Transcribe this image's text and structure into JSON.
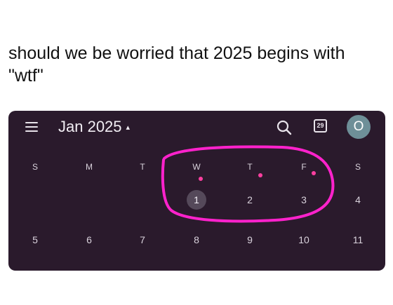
{
  "caption": "should we be worried that 2025 begins with \"wtf\"",
  "header": {
    "month_title": "Jan 2025",
    "caret": "▴",
    "today_badge": "29",
    "avatar_initial": "O"
  },
  "weekdays": [
    "S",
    "M",
    "T",
    "W",
    "T",
    "F",
    "S"
  ],
  "weeks": [
    [
      "",
      "",
      "",
      "1",
      "2",
      "3",
      "4"
    ],
    [
      "5",
      "6",
      "7",
      "8",
      "9",
      "10",
      "11"
    ]
  ],
  "today": "1",
  "colors": {
    "background": "#2a1a2c",
    "annotation": "#ff22cc",
    "event_dot": "#ff3fa0",
    "avatar": "#6e8f98"
  },
  "icons": [
    "menu-icon",
    "search-icon",
    "today-calendar-icon",
    "caret-up-icon"
  ]
}
